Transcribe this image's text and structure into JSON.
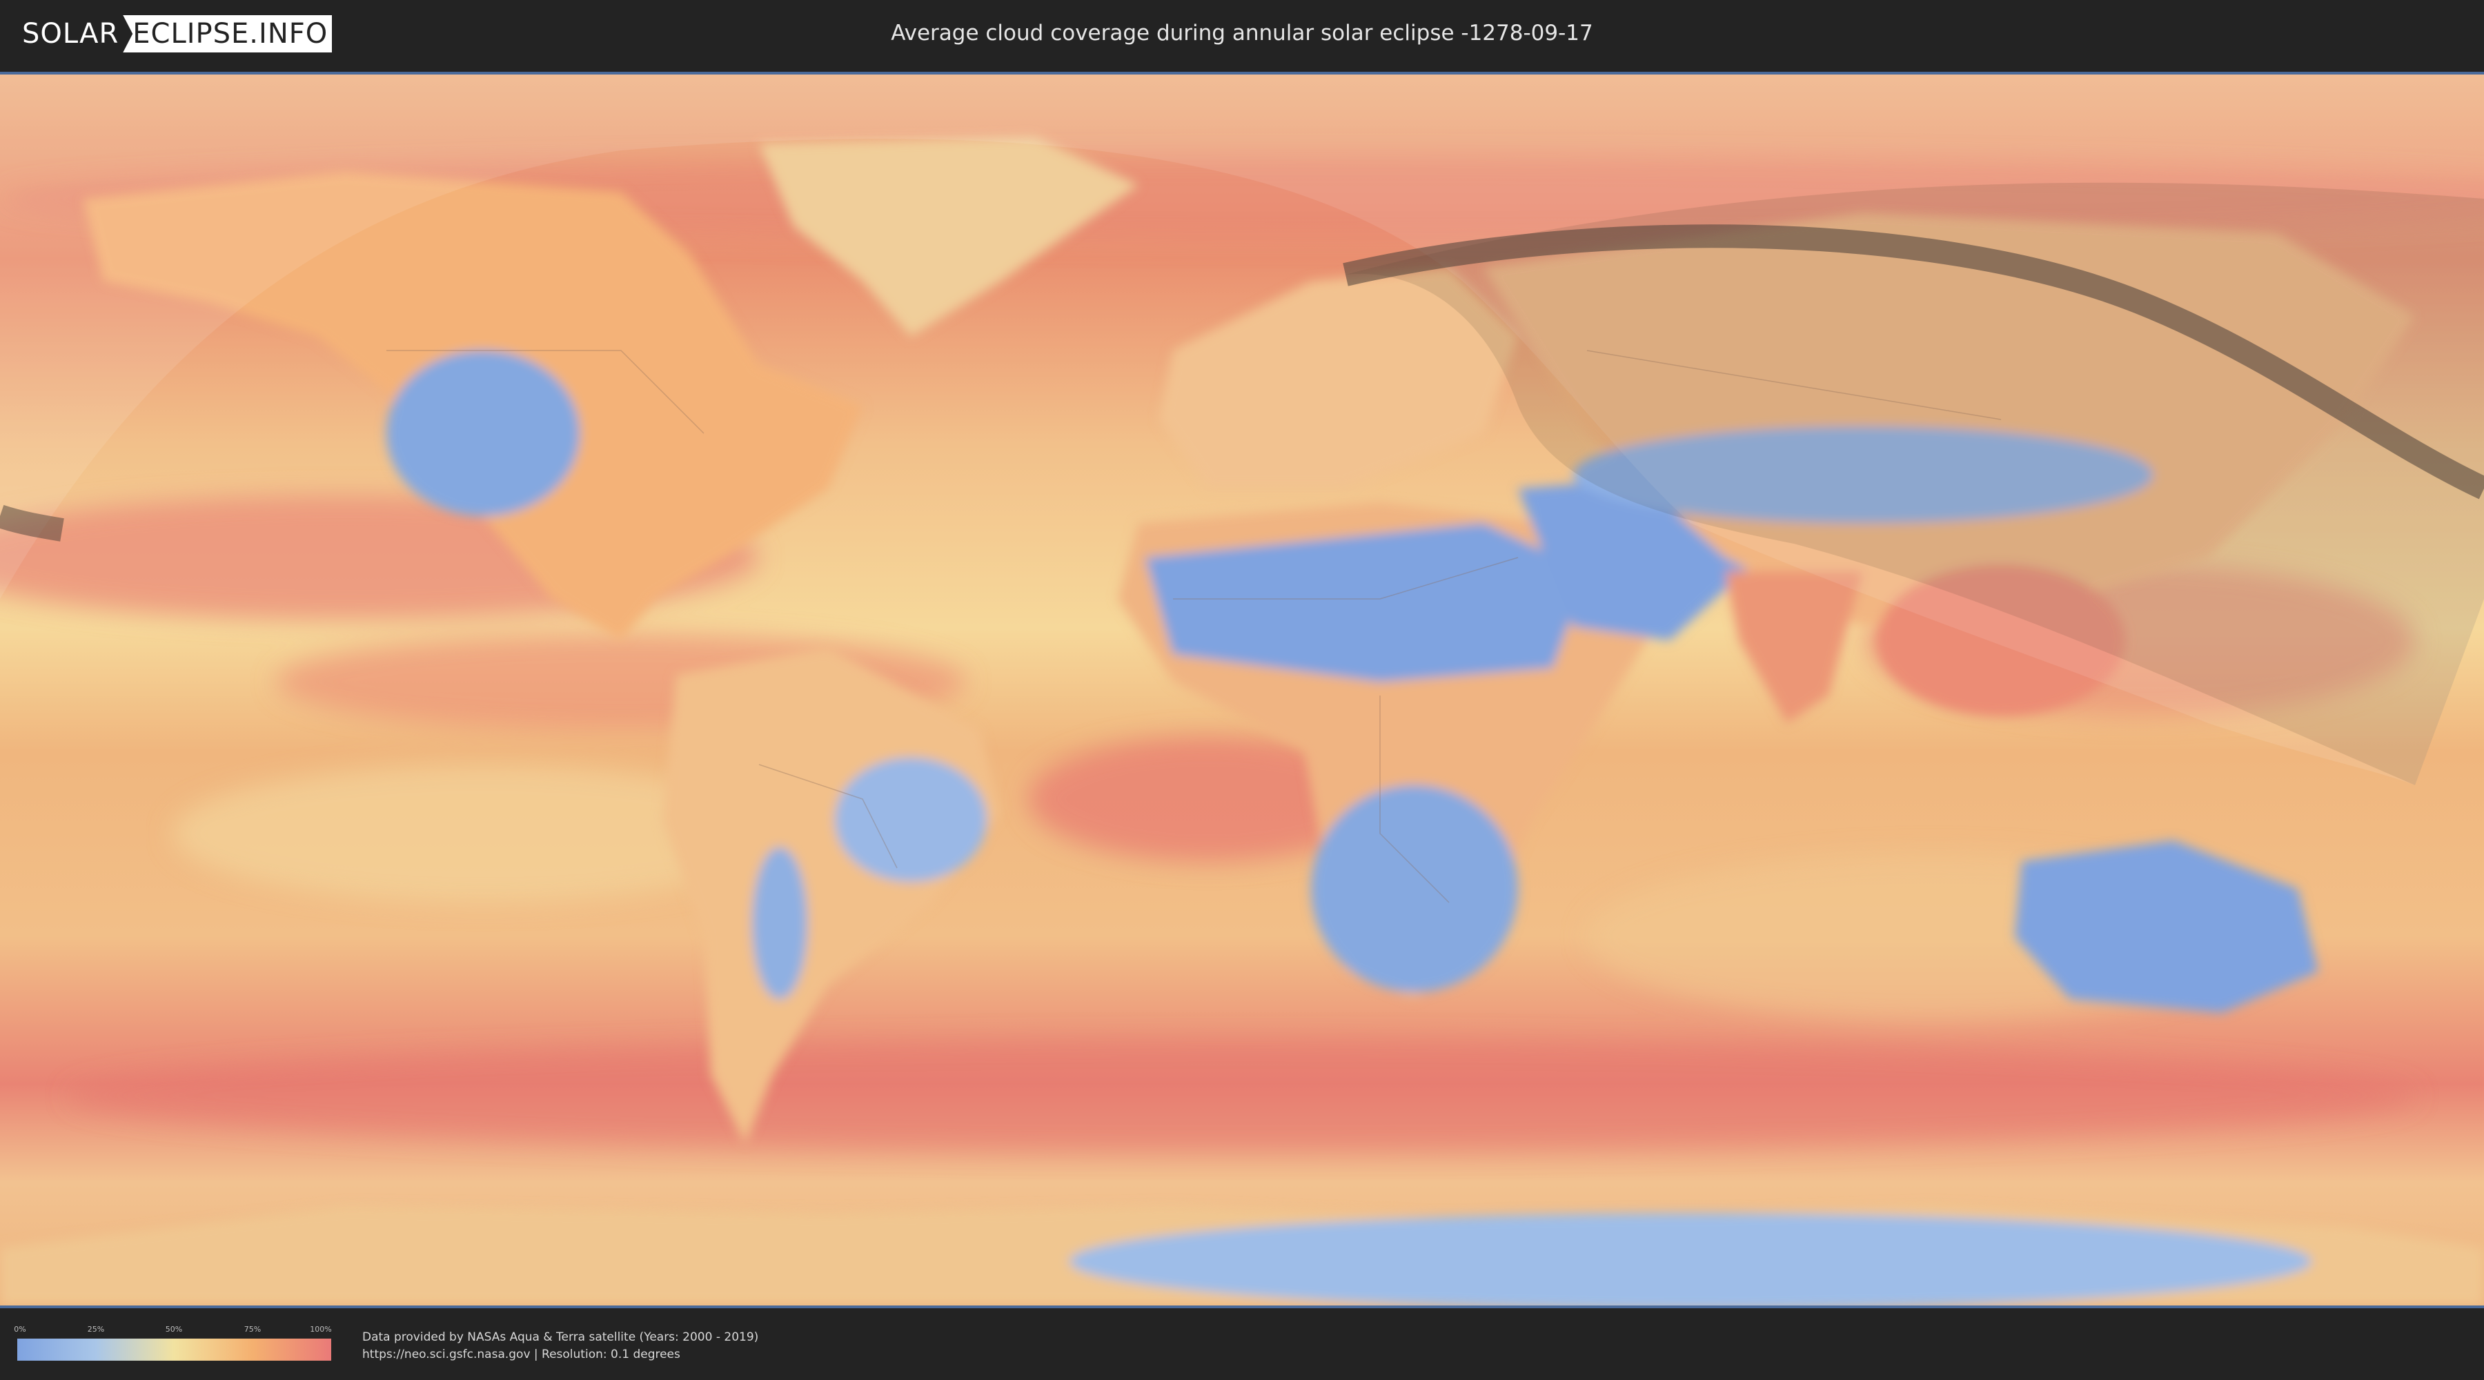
{
  "logo": {
    "part1": "SOLAR",
    "part2": "ECLIPSE.INFO"
  },
  "title": "Average cloud coverage during annular solar eclipse -1278-09-17",
  "legend": {
    "ticks": [
      "0%",
      "25%",
      "50%",
      "75%",
      "100%"
    ]
  },
  "credits": {
    "line1": "Data provided by NASAs Aqua & Terra satellite (Years: 2000 - 2019)",
    "line2": "https://neo.sci.gsfc.nasa.gov | Resolution: 0.1 degrees"
  },
  "colors": {
    "clear": "#7fa3e0",
    "low": "#a9c6e8",
    "mid": "#f2e2a0",
    "high": "#f4b070",
    "overcast": "#ea7a78",
    "frame": "#4a6a9a",
    "background": "#232323"
  }
}
